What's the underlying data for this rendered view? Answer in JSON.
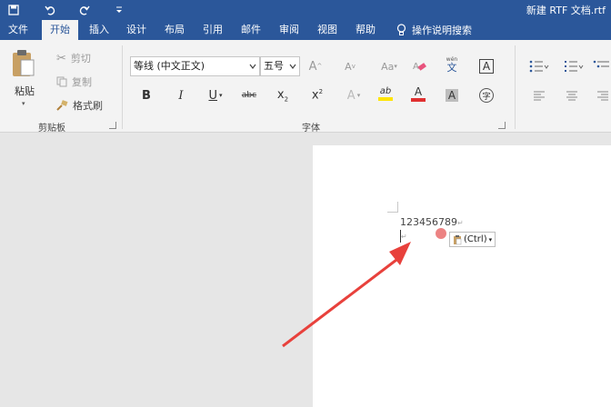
{
  "title_bar": {
    "doc_title": "新建 RTF 文档.rtf",
    "qat": [
      "save-icon",
      "undo-icon",
      "redo-icon",
      "customize-icon"
    ]
  },
  "tabs": [
    "文件",
    "开始",
    "插入",
    "设计",
    "布局",
    "引用",
    "邮件",
    "审阅",
    "视图",
    "帮助"
  ],
  "active_tab": "开始",
  "tell_me": "操作说明搜索",
  "clipboard": {
    "paste": "粘贴",
    "cut": "剪切",
    "copy": "复制",
    "format_painter": "格式刷",
    "group_label": "剪贴板"
  },
  "font": {
    "font_name": "等线 (中文正文)",
    "font_size": "五号",
    "group_label": "字体",
    "phonetic_guide_text": "wén",
    "phonetic_char": "文",
    "char_border": "A",
    "char_shading": "A",
    "enclose_char": "字",
    "change_case": "Aa",
    "grow": "A",
    "shrink": "A",
    "bold": "B",
    "italic": "I",
    "underline": "U",
    "strike": "abc",
    "subscript": "x",
    "superscript": "x",
    "sub_digit": "2",
    "sup_digit": "2",
    "text_effects": "A",
    "highlight": "ab",
    "font_color": "A"
  },
  "document": {
    "line1": "123456789",
    "paste_options": "(Ctrl)"
  },
  "colors": {
    "brand": "#2b579a",
    "highlight": "#ffe400",
    "font_color": "#e03030",
    "arrow": "#e8413c"
  }
}
